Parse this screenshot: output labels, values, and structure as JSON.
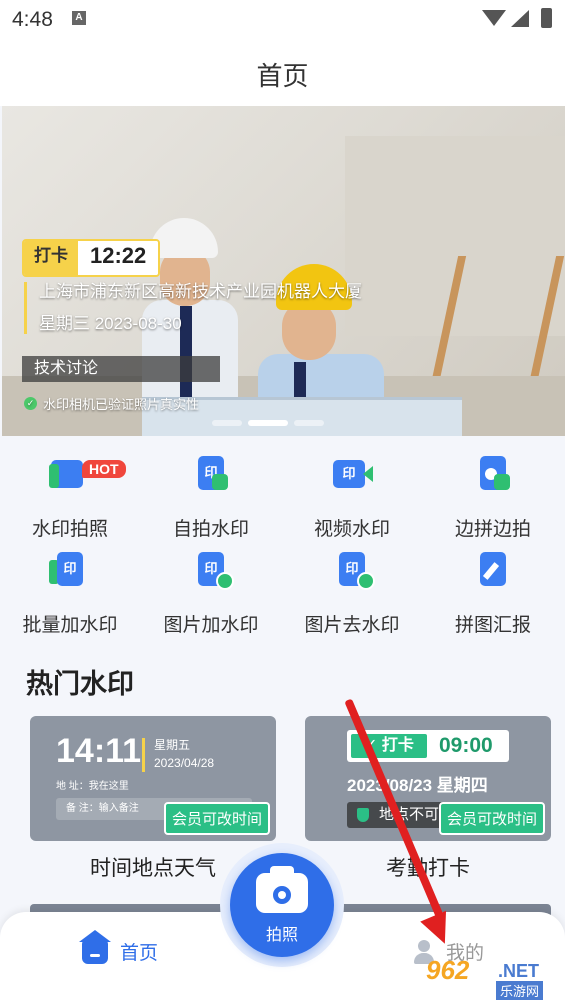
{
  "status_bar": {
    "time": "4:48",
    "notif_icon": "A"
  },
  "header": {
    "title": "首页"
  },
  "banner": {
    "tag_label": "打卡",
    "tag_time": "12:22",
    "address": "上海市浦东新区高新技术产业园机器人大厦",
    "date": "星期三   2023-08-30",
    "note": "技术讨论",
    "verify": "水印相机已验证照片真实性"
  },
  "features": [
    {
      "label": "水印拍照",
      "icon": "watermark-photo-icon",
      "badge": "HOT"
    },
    {
      "label": "自拍水印",
      "icon": "selfie-watermark-icon",
      "glyph": "印"
    },
    {
      "label": "视频水印",
      "icon": "video-watermark-icon",
      "glyph": "印"
    },
    {
      "label": "边拼边拍",
      "icon": "stitch-shoot-icon"
    },
    {
      "label": "批量加水印",
      "icon": "batch-watermark-icon",
      "glyph": "印"
    },
    {
      "label": "图片加水印",
      "icon": "image-add-watermark-icon",
      "glyph": "印"
    },
    {
      "label": "图片去水印",
      "icon": "image-remove-watermark-icon",
      "glyph": "印"
    },
    {
      "label": "拼图汇报",
      "icon": "collage-report-icon"
    }
  ],
  "hot_section": {
    "title": "热门水印"
  },
  "templates": [
    {
      "name": "时间地点天气",
      "time": "14:11",
      "weekday": "星期五",
      "date": "2023/04/28",
      "address": "地   址：我在这里",
      "remark": "备   注：输入备注",
      "vip": "会员可改时间"
    },
    {
      "name": "考勤打卡",
      "label": "打卡",
      "time": "09:00",
      "date": "2023/08/23  星期四",
      "location": "地点不可",
      "vip": "会员可改时间"
    }
  ],
  "fab": {
    "label": "拍照"
  },
  "nav": {
    "home": "首页",
    "mine": "我的"
  },
  "watermark_brand": {
    "number": "962",
    "net": ".NET",
    "cn": "乐游网"
  },
  "colors": {
    "primary": "#2f6ee8",
    "green": "#2bbf86",
    "hot": "#f0463c",
    "yellow": "#f6d24a"
  }
}
